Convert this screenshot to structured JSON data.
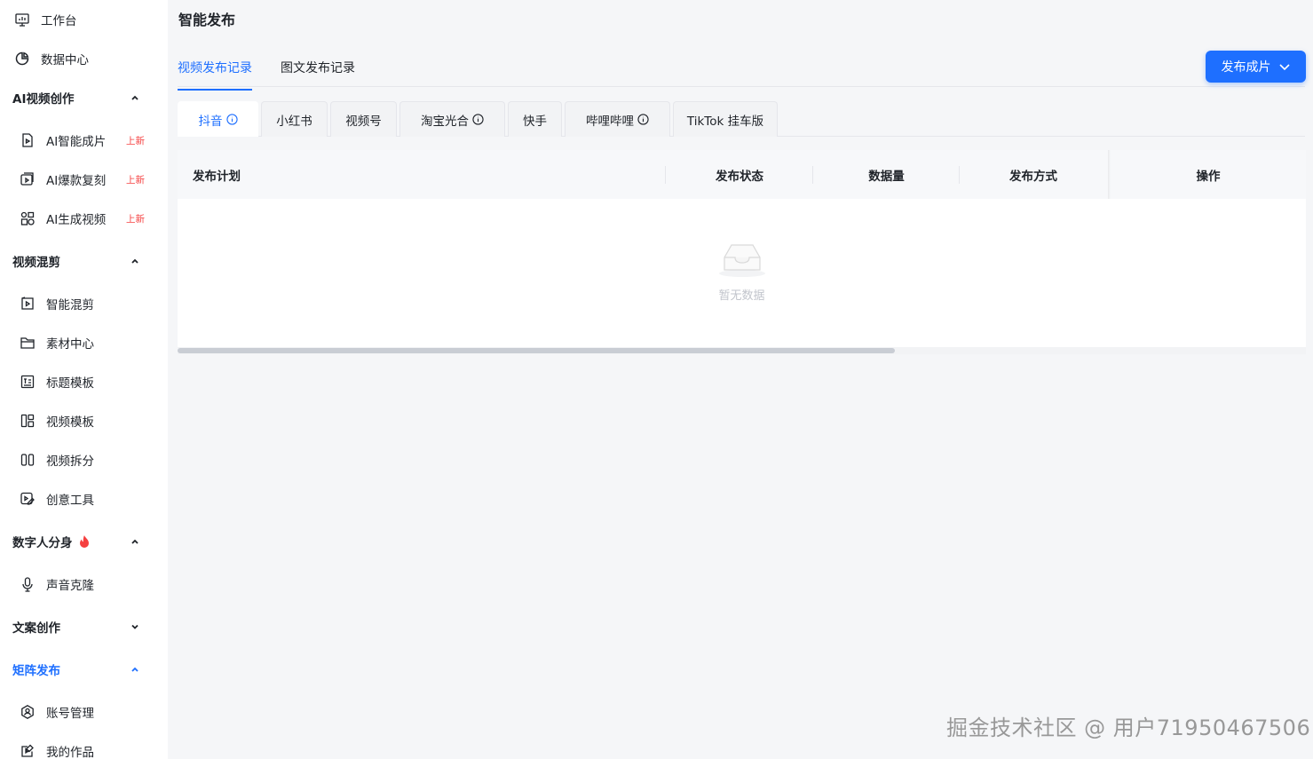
{
  "sidebar": {
    "workbench": "工作台",
    "data_center": "数据中心",
    "ai_video": {
      "title": "AI视频创作",
      "items": [
        {
          "label": "AI智能成片",
          "badge": "上新"
        },
        {
          "label": "AI爆款复刻",
          "badge": "上新"
        },
        {
          "label": "AI生成视频",
          "badge": "上新"
        }
      ]
    },
    "video_mix": {
      "title": "视频混剪",
      "items": [
        {
          "label": "智能混剪"
        },
        {
          "label": "素材中心"
        },
        {
          "label": "标题模板"
        },
        {
          "label": "视频模板"
        },
        {
          "label": "视频拆分"
        },
        {
          "label": "创意工具"
        }
      ]
    },
    "digital_human": {
      "title": "数字人分身",
      "items": [
        {
          "label": "声音克隆"
        }
      ]
    },
    "copywriting": {
      "title": "文案创作"
    },
    "matrix": {
      "title": "矩阵发布",
      "items": [
        {
          "label": "账号管理"
        },
        {
          "label": "我的作品"
        }
      ]
    }
  },
  "page": {
    "title": "智能发布",
    "tabs": [
      {
        "label": "视频发布记录"
      },
      {
        "label": "图文发布记录"
      }
    ],
    "publish_button": "发布成片",
    "platforms": [
      {
        "label": "抖音"
      },
      {
        "label": "小红书"
      },
      {
        "label": "视频号"
      },
      {
        "label": "淘宝光合"
      },
      {
        "label": "快手"
      },
      {
        "label": "哔哩哔哩"
      },
      {
        "label": "TikTok 挂车版"
      }
    ],
    "table": {
      "columns": [
        "发布计划",
        "发布状态",
        "数据量",
        "发布方式",
        "操作"
      ],
      "empty_text": "暂无数据"
    }
  },
  "watermark": "掘金技术社区 @ 用户71950467506",
  "colors": {
    "accent": "#1e6fff",
    "new_badge": "#f53f3f"
  }
}
